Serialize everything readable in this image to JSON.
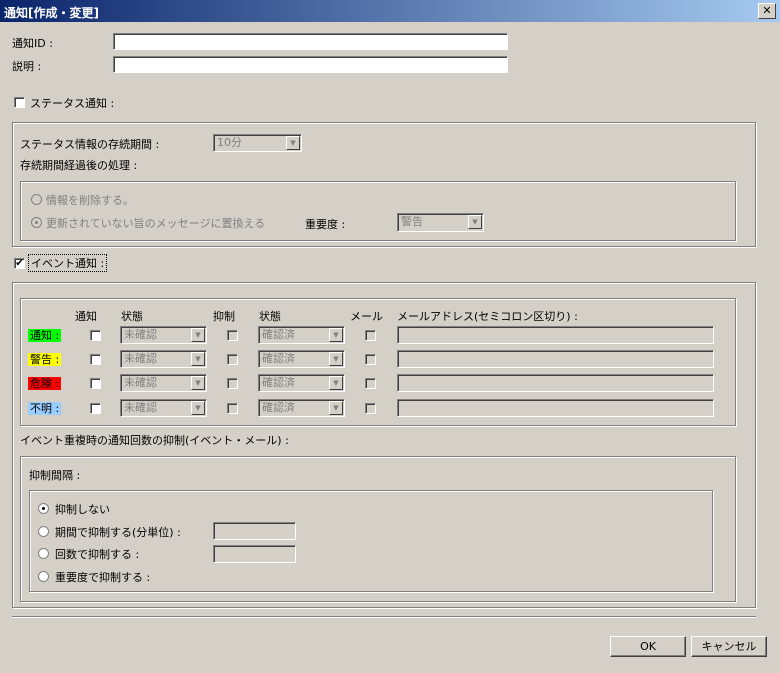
{
  "window": {
    "title": "通知[作成・変更]",
    "close_glyph": "✕"
  },
  "fields": {
    "id_label": "通知ID :",
    "id_value": "",
    "desc_label": "説明 :",
    "desc_value": ""
  },
  "status": {
    "toggle_label": "ステータス通知 :",
    "checked": false,
    "retention_label": "ステータス情報の存続期間 :",
    "retention_value": "10分",
    "after_label": "存続期間経過後の処理 :",
    "opt_delete": "情報を削除する。",
    "opt_replace": "更新されていない旨のメッセージに置換える",
    "severity_label": "重要度 :",
    "severity_value": "警告"
  },
  "event": {
    "toggle_label": "イベント通知 :",
    "checked": true,
    "headers": {
      "notify": "通知",
      "state1": "状態",
      "suppress": "抑制",
      "state2": "状態",
      "mail": "メール",
      "mail_address": "メールアドレス(セミコロン区切り) :"
    },
    "rows": [
      {
        "label": "通知 :",
        "color": "#00ff00",
        "state1": "未確認",
        "state2": "確認済"
      },
      {
        "label": "警告 :",
        "color": "#ffff00",
        "state1": "未確認",
        "state2": "確認済"
      },
      {
        "label": "危険 :",
        "color": "#ff0000",
        "state1": "未確認",
        "state2": "確認済"
      },
      {
        "label": "不明 :",
        "color": "#99ccff",
        "state1": "未確認",
        "state2": "確認済"
      }
    ],
    "dup_label": "イベント重複時の通知回数の抑制(イベント・メール) :",
    "interval_label": "抑制間隔 :",
    "opt_none": "抑制しない",
    "opt_period": "期間で抑制する(分単位) :",
    "opt_count": "回数で抑制する :",
    "opt_severity": "重要度で抑制する :"
  },
  "buttons": {
    "ok": "OK",
    "cancel": "キャンセル"
  }
}
